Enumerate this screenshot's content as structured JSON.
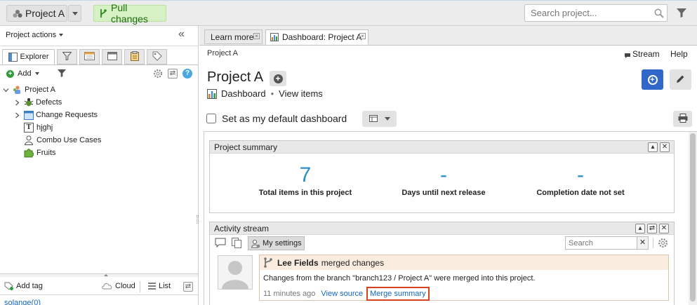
{
  "topbar": {
    "project_label": "Project A",
    "pull_changes_label": "Pull changes",
    "search_placeholder": "Search project..."
  },
  "left_panel": {
    "title": "Project actions",
    "tabs": {
      "explorer_label": "Explorer"
    },
    "toolbar": {
      "add_label": "Add"
    },
    "tree": {
      "root": "Project A",
      "items": [
        "Defects",
        "Change Requests",
        "hjghj",
        "Combo Use Cases",
        "Fruits"
      ]
    },
    "footer": {
      "add_tag_label": "Add tag",
      "cloud_label": "Cloud",
      "list_label": "List",
      "tag_item": "solange(0)"
    }
  },
  "tabs": [
    {
      "label": "Learn more"
    },
    {
      "label": "Dashboard: Project A"
    }
  ],
  "dashboard": {
    "breadcrumb": "Project A",
    "stream_label": "Stream",
    "help_label": "Help",
    "title": "Project A",
    "dashboard_link": "Dashboard",
    "separator": "•",
    "view_items_link": "View items",
    "default_checkbox_label": "Set as my default dashboard",
    "default_checked": false
  },
  "project_summary": {
    "title": "Project summary",
    "stats": [
      {
        "value": "7",
        "label": "Total items in this project"
      },
      {
        "value": "-",
        "label": "Days until next release"
      },
      {
        "value": "-",
        "label": "Completion date not set"
      }
    ]
  },
  "activity_stream": {
    "title": "Activity stream",
    "my_settings_label": "My settings",
    "search_placeholder": "Search",
    "entry": {
      "user": "Lee Fields",
      "action": "merged changes",
      "description": "Changes from the branch \"branch123 / Project A\" were merged into this project.",
      "time": "11 minutes ago",
      "view_source_label": "View source",
      "merge_summary_label": "Merge summary"
    }
  },
  "colors": {
    "accent_blue": "#2a8fc7",
    "pull_green_bg": "#d6f1c4",
    "highlight_red": "#d9401c",
    "entry_header_bg": "#fbece0"
  }
}
